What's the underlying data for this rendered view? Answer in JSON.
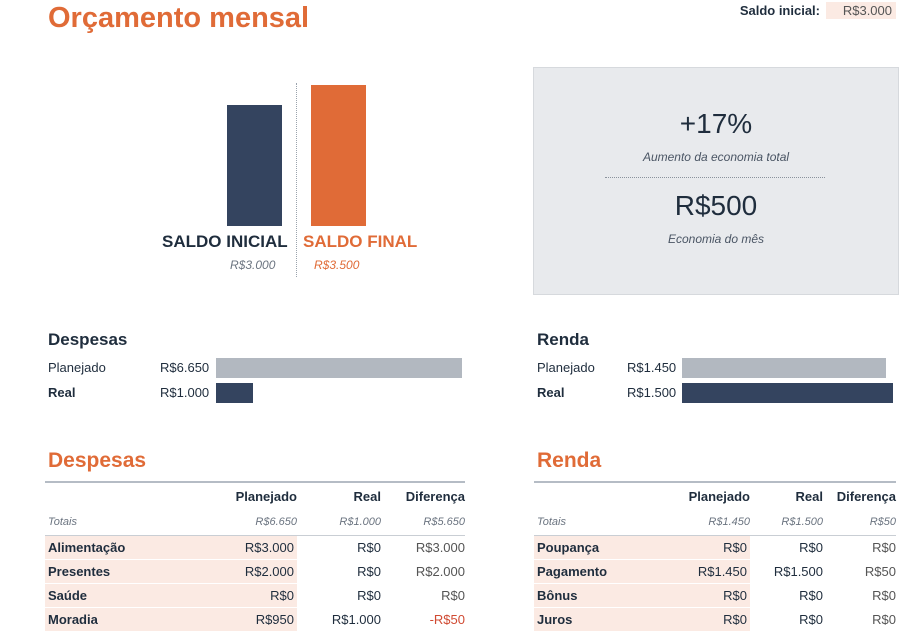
{
  "header": {
    "title": "Orçamento mensal",
    "saldo_inicial_label": "Saldo inicial:",
    "saldo_inicial_value": "R$3.000"
  },
  "saldo_chart": {
    "start_label": "SALDO INICIAL",
    "start_value": "R$3.000",
    "end_label": "SALDO FINAL",
    "end_value": "R$3.500",
    "colors": {
      "start": "#34445f",
      "end": "#e06b37"
    }
  },
  "summary": {
    "percent": "+17%",
    "percent_label": "Aumento da economia total",
    "amount": "R$500",
    "amount_label": "Economia do mês"
  },
  "despesas_bars": {
    "title": "Despesas",
    "planned_label": "Planejado",
    "planned_value": "R$6.650",
    "planned_fraction": 1.0,
    "real_label": "Real",
    "real_value": "R$1.000",
    "real_fraction": 0.15
  },
  "renda_bars": {
    "title": "Renda",
    "planned_label": "Planejado",
    "planned_value": "R$1.450",
    "planned_fraction": 0.967,
    "real_label": "Real",
    "real_value": "R$1.500",
    "real_fraction": 1.0
  },
  "despesas_table": {
    "title": "Despesas",
    "headers": [
      "",
      "Planejado",
      "Real",
      "Diferença"
    ],
    "totals": [
      "Totais",
      "R$6.650",
      "R$1.000",
      "R$5.650"
    ],
    "rows": [
      [
        "Alimentação",
        "R$3.000",
        "R$0",
        "R$3.000"
      ],
      [
        "Presentes",
        "R$2.000",
        "R$0",
        "R$2.000"
      ],
      [
        "Saúde",
        "R$0",
        "R$0",
        "R$0"
      ],
      [
        "Moradia",
        "R$950",
        "R$1.000",
        "-R$50"
      ]
    ]
  },
  "renda_table": {
    "title": "Renda",
    "headers": [
      "",
      "Planejado",
      "Real",
      "Diferença"
    ],
    "totals": [
      "Totais",
      "R$1.450",
      "R$1.500",
      "R$50"
    ],
    "rows": [
      [
        "Poupança",
        "R$0",
        "R$0",
        "R$0"
      ],
      [
        "Pagamento",
        "R$1.450",
        "R$1.500",
        "R$50"
      ],
      [
        "Bônus",
        "R$0",
        "R$0",
        "R$0"
      ],
      [
        "Juros",
        "R$0",
        "R$0",
        "R$0"
      ]
    ]
  }
}
